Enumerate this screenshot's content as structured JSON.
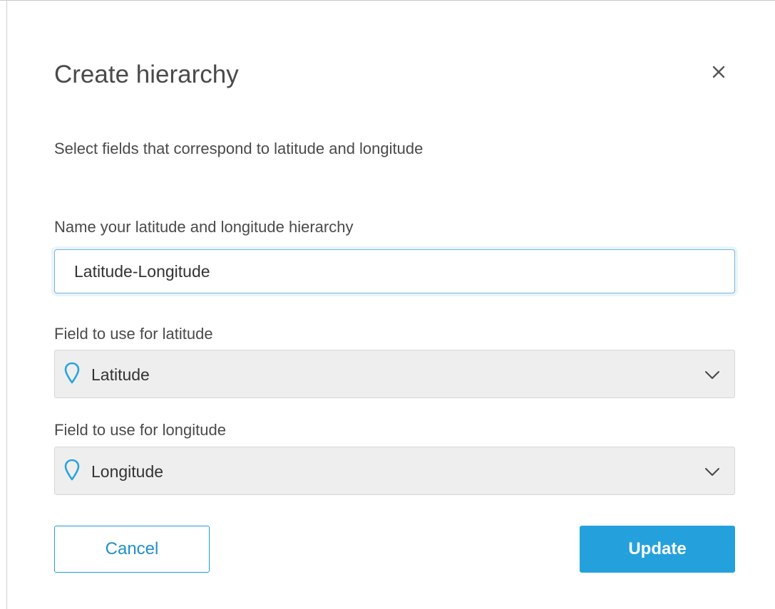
{
  "dialog": {
    "title": "Create hierarchy",
    "subtitle": "Select fields that correspond to latitude and longitude",
    "close_icon": "close-icon"
  },
  "name_field": {
    "label": "Name your latitude and longitude hierarchy",
    "value": "Latitude-Longitude"
  },
  "latitude_field": {
    "label": "Field to use for latitude",
    "selected": "Latitude",
    "icon": "map-pin-icon"
  },
  "longitude_field": {
    "label": "Field to use for longitude",
    "selected": "Longitude",
    "icon": "map-pin-icon"
  },
  "buttons": {
    "cancel_label": "Cancel",
    "update_label": "Update"
  },
  "colors": {
    "accent": "#24a1dc",
    "text": "#4a4a4a",
    "select_bg": "#eeeeee",
    "focus_border": "#6fb6df"
  }
}
